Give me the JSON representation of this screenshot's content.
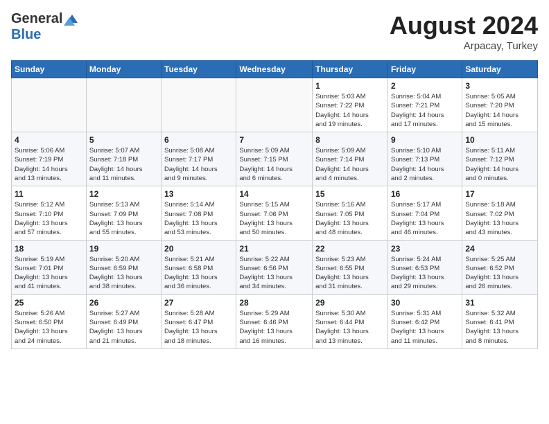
{
  "header": {
    "logo_general": "General",
    "logo_blue": "Blue",
    "month_title": "August 2024",
    "location": "Arpacay, Turkey"
  },
  "weekdays": [
    "Sunday",
    "Monday",
    "Tuesday",
    "Wednesday",
    "Thursday",
    "Friday",
    "Saturday"
  ],
  "weeks": [
    [
      {
        "day": "",
        "info": ""
      },
      {
        "day": "",
        "info": ""
      },
      {
        "day": "",
        "info": ""
      },
      {
        "day": "",
        "info": ""
      },
      {
        "day": "1",
        "info": "Sunrise: 5:03 AM\nSunset: 7:22 PM\nDaylight: 14 hours\nand 19 minutes."
      },
      {
        "day": "2",
        "info": "Sunrise: 5:04 AM\nSunset: 7:21 PM\nDaylight: 14 hours\nand 17 minutes."
      },
      {
        "day": "3",
        "info": "Sunrise: 5:05 AM\nSunset: 7:20 PM\nDaylight: 14 hours\nand 15 minutes."
      }
    ],
    [
      {
        "day": "4",
        "info": "Sunrise: 5:06 AM\nSunset: 7:19 PM\nDaylight: 14 hours\nand 13 minutes."
      },
      {
        "day": "5",
        "info": "Sunrise: 5:07 AM\nSunset: 7:18 PM\nDaylight: 14 hours\nand 11 minutes."
      },
      {
        "day": "6",
        "info": "Sunrise: 5:08 AM\nSunset: 7:17 PM\nDaylight: 14 hours\nand 9 minutes."
      },
      {
        "day": "7",
        "info": "Sunrise: 5:09 AM\nSunset: 7:15 PM\nDaylight: 14 hours\nand 6 minutes."
      },
      {
        "day": "8",
        "info": "Sunrise: 5:09 AM\nSunset: 7:14 PM\nDaylight: 14 hours\nand 4 minutes."
      },
      {
        "day": "9",
        "info": "Sunrise: 5:10 AM\nSunset: 7:13 PM\nDaylight: 14 hours\nand 2 minutes."
      },
      {
        "day": "10",
        "info": "Sunrise: 5:11 AM\nSunset: 7:12 PM\nDaylight: 14 hours\nand 0 minutes."
      }
    ],
    [
      {
        "day": "11",
        "info": "Sunrise: 5:12 AM\nSunset: 7:10 PM\nDaylight: 13 hours\nand 57 minutes."
      },
      {
        "day": "12",
        "info": "Sunrise: 5:13 AM\nSunset: 7:09 PM\nDaylight: 13 hours\nand 55 minutes."
      },
      {
        "day": "13",
        "info": "Sunrise: 5:14 AM\nSunset: 7:08 PM\nDaylight: 13 hours\nand 53 minutes."
      },
      {
        "day": "14",
        "info": "Sunrise: 5:15 AM\nSunset: 7:06 PM\nDaylight: 13 hours\nand 50 minutes."
      },
      {
        "day": "15",
        "info": "Sunrise: 5:16 AM\nSunset: 7:05 PM\nDaylight: 13 hours\nand 48 minutes."
      },
      {
        "day": "16",
        "info": "Sunrise: 5:17 AM\nSunset: 7:04 PM\nDaylight: 13 hours\nand 46 minutes."
      },
      {
        "day": "17",
        "info": "Sunrise: 5:18 AM\nSunset: 7:02 PM\nDaylight: 13 hours\nand 43 minutes."
      }
    ],
    [
      {
        "day": "18",
        "info": "Sunrise: 5:19 AM\nSunset: 7:01 PM\nDaylight: 13 hours\nand 41 minutes."
      },
      {
        "day": "19",
        "info": "Sunrise: 5:20 AM\nSunset: 6:59 PM\nDaylight: 13 hours\nand 38 minutes."
      },
      {
        "day": "20",
        "info": "Sunrise: 5:21 AM\nSunset: 6:58 PM\nDaylight: 13 hours\nand 36 minutes."
      },
      {
        "day": "21",
        "info": "Sunrise: 5:22 AM\nSunset: 6:56 PM\nDaylight: 13 hours\nand 34 minutes."
      },
      {
        "day": "22",
        "info": "Sunrise: 5:23 AM\nSunset: 6:55 PM\nDaylight: 13 hours\nand 31 minutes."
      },
      {
        "day": "23",
        "info": "Sunrise: 5:24 AM\nSunset: 6:53 PM\nDaylight: 13 hours\nand 29 minutes."
      },
      {
        "day": "24",
        "info": "Sunrise: 5:25 AM\nSunset: 6:52 PM\nDaylight: 13 hours\nand 26 minutes."
      }
    ],
    [
      {
        "day": "25",
        "info": "Sunrise: 5:26 AM\nSunset: 6:50 PM\nDaylight: 13 hours\nand 24 minutes."
      },
      {
        "day": "26",
        "info": "Sunrise: 5:27 AM\nSunset: 6:49 PM\nDaylight: 13 hours\nand 21 minutes."
      },
      {
        "day": "27",
        "info": "Sunrise: 5:28 AM\nSunset: 6:47 PM\nDaylight: 13 hours\nand 18 minutes."
      },
      {
        "day": "28",
        "info": "Sunrise: 5:29 AM\nSunset: 6:46 PM\nDaylight: 13 hours\nand 16 minutes."
      },
      {
        "day": "29",
        "info": "Sunrise: 5:30 AM\nSunset: 6:44 PM\nDaylight: 13 hours\nand 13 minutes."
      },
      {
        "day": "30",
        "info": "Sunrise: 5:31 AM\nSunset: 6:42 PM\nDaylight: 13 hours\nand 11 minutes."
      },
      {
        "day": "31",
        "info": "Sunrise: 5:32 AM\nSunset: 6:41 PM\nDaylight: 13 hours\nand 8 minutes."
      }
    ]
  ]
}
